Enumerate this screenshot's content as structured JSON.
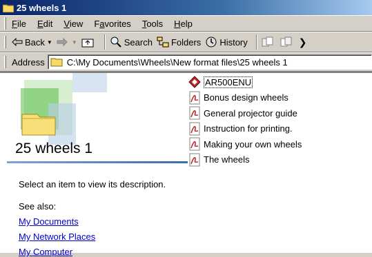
{
  "window": {
    "title": "25 wheels 1"
  },
  "menu": [
    {
      "label": "File",
      "key": "F",
      "rest": "ile"
    },
    {
      "label": "Edit",
      "key": "E",
      "rest": "dit"
    },
    {
      "label": "View",
      "key": "V",
      "rest": "iew"
    },
    {
      "label": "Favorites",
      "pre": "F",
      "key": "a",
      "rest": "vorites"
    },
    {
      "label": "Tools",
      "key": "T",
      "rest": "ools"
    },
    {
      "label": "Help",
      "key": "H",
      "rest": "elp"
    }
  ],
  "toolbar": {
    "back_label": "Back",
    "search_label": "Search",
    "folders_label": "Folders",
    "history_label": "History"
  },
  "address": {
    "label": "Address",
    "value": "C:\\My Documents\\Wheels\\New format files\\25 wheels 1"
  },
  "left_pane": {
    "folder_name": "25 wheels 1",
    "description": "Select an item to view its description.",
    "see_also": "See also:",
    "links": [
      "My Documents",
      "My Network Places",
      "My Computer"
    ]
  },
  "files": [
    {
      "name": "AR500ENU",
      "icon": "acrobat-app-icon"
    },
    {
      "name": "Bonus design wheels",
      "icon": "pdf-icon"
    },
    {
      "name": "General projector guide",
      "icon": "pdf-icon"
    },
    {
      "name": "Instruction for printing.",
      "icon": "pdf-icon"
    },
    {
      "name": "Making your own wheels",
      "icon": "pdf-icon"
    },
    {
      "name": "The wheels",
      "icon": "pdf-icon"
    }
  ]
}
